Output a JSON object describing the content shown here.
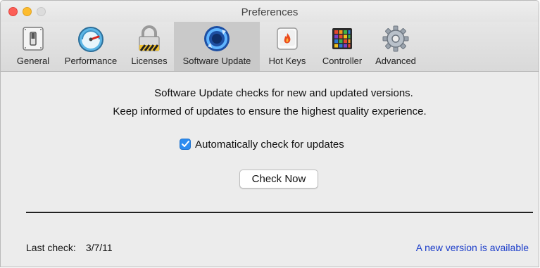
{
  "window": {
    "title": "Preferences"
  },
  "toolbar": {
    "items": [
      {
        "label": "General",
        "icon": "switch-icon",
        "selected": false
      },
      {
        "label": "Performance",
        "icon": "gauge-icon",
        "selected": false
      },
      {
        "label": "Licenses",
        "icon": "padlock-icon",
        "selected": false
      },
      {
        "label": "Software Update",
        "icon": "sync-icon",
        "selected": true
      },
      {
        "label": "Hot Keys",
        "icon": "flame-key-icon",
        "selected": false
      },
      {
        "label": "Controller",
        "icon": "pad-controller-icon",
        "selected": false
      },
      {
        "label": "Advanced",
        "icon": "gear-icon",
        "selected": false
      }
    ]
  },
  "main": {
    "description_line1": "Software Update checks for new and updated versions.",
    "description_line2": "Keep informed of updates to ensure the highest quality experience.",
    "auto_check": {
      "label": "Automatically check for updates",
      "checked": true
    },
    "check_now_label": "Check Now"
  },
  "footer": {
    "last_check_label": "Last check:",
    "last_check_value": "3/7/11",
    "status_link": "A new version is available"
  },
  "colors": {
    "accent": "#2d8cf0",
    "link": "#1a3cc9"
  }
}
